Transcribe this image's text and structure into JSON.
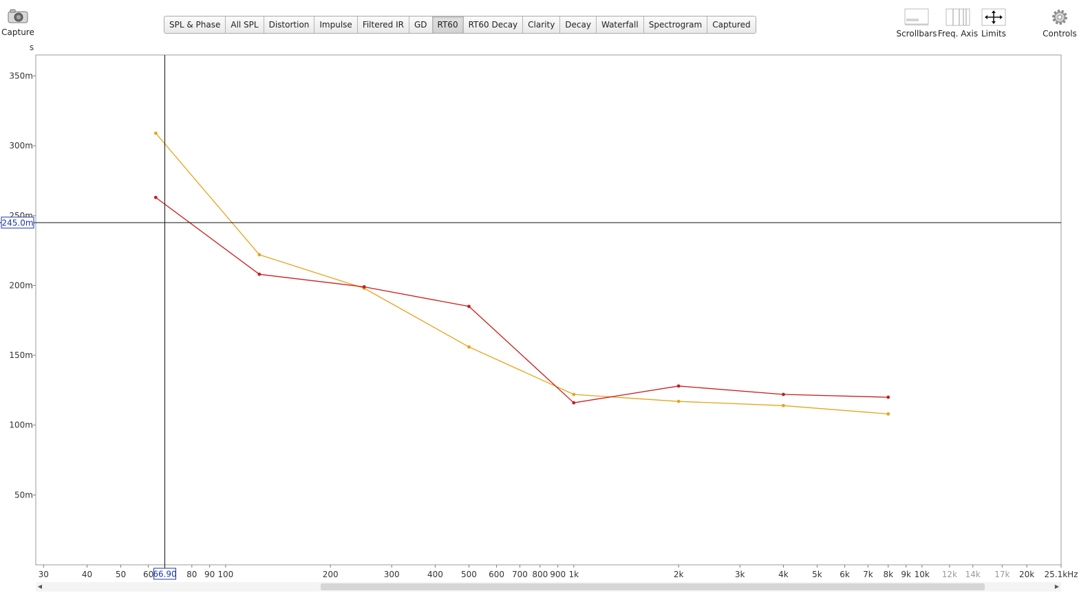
{
  "toolbar": {
    "capture": "Capture",
    "scrollbars": "Scrollbars",
    "freq_axis": "Freq. Axis",
    "limits": "Limits",
    "controls": "Controls"
  },
  "tabs": [
    {
      "label": "SPL & Phase"
    },
    {
      "label": "All SPL"
    },
    {
      "label": "Distortion"
    },
    {
      "label": "Impulse"
    },
    {
      "label": "Filtered IR"
    },
    {
      "label": "GD"
    },
    {
      "label": "RT60",
      "active": true
    },
    {
      "label": "RT60 Decay"
    },
    {
      "label": "Clarity"
    },
    {
      "label": "Decay"
    },
    {
      "label": "Waterfall"
    },
    {
      "label": "Spectrogram"
    },
    {
      "label": "Captured"
    }
  ],
  "cursor": {
    "freq_readout": "66.90",
    "value_readout": "245.0m",
    "freq": 66.9,
    "value": 0.245
  },
  "chart_data": {
    "type": "line",
    "ylabel": "s",
    "xscale": "log",
    "xlim": [
      28.5,
      25100
    ],
    "ylim": [
      0,
      0.365
    ],
    "grid": true,
    "yticks": [
      {
        "v": 0.05,
        "label": "50m"
      },
      {
        "v": 0.1,
        "label": "100m"
      },
      {
        "v": 0.15,
        "label": "150m"
      },
      {
        "v": 0.2,
        "label": "200m"
      },
      {
        "v": 0.25,
        "label": "250m"
      },
      {
        "v": 0.3,
        "label": "300m"
      },
      {
        "v": 0.35,
        "label": "350m"
      }
    ],
    "xticks": [
      {
        "v": 30,
        "label": "30"
      },
      {
        "v": 40,
        "label": "40"
      },
      {
        "v": 50,
        "label": "50"
      },
      {
        "v": 60,
        "label": "60"
      },
      {
        "v": 80,
        "label": "80"
      },
      {
        "v": 90,
        "label": "90"
      },
      {
        "v": 100,
        "label": "100"
      },
      {
        "v": 200,
        "label": "200"
      },
      {
        "v": 300,
        "label": "300"
      },
      {
        "v": 400,
        "label": "400"
      },
      {
        "v": 500,
        "label": "500"
      },
      {
        "v": 600,
        "label": "600"
      },
      {
        "v": 700,
        "label": "700"
      },
      {
        "v": 800,
        "label": "800"
      },
      {
        "v": 900,
        "label": "900"
      },
      {
        "v": 1000,
        "label": "1k"
      },
      {
        "v": 2000,
        "label": "2k"
      },
      {
        "v": 3000,
        "label": "3k"
      },
      {
        "v": 4000,
        "label": "4k"
      },
      {
        "v": 5000,
        "label": "5k"
      },
      {
        "v": 6000,
        "label": "6k"
      },
      {
        "v": 7000,
        "label": "7k"
      },
      {
        "v": 8000,
        "label": "8k"
      },
      {
        "v": 9000,
        "label": "9k"
      },
      {
        "v": 10000,
        "label": "10k"
      },
      {
        "v": 12000,
        "label": "12k",
        "faded": true
      },
      {
        "v": 14000,
        "label": "14k",
        "faded": true
      },
      {
        "v": 17000,
        "label": "17k",
        "faded": true
      },
      {
        "v": 20000,
        "label": "20k"
      },
      {
        "v": 25100,
        "label": "25.1kHz"
      }
    ],
    "valid_range_max": 10000,
    "series": [
      {
        "color": "#e8a317",
        "points": [
          [
            63,
            0.309
          ],
          [
            125,
            0.222
          ],
          [
            250,
            0.198
          ],
          [
            500,
            0.156
          ],
          [
            1000,
            0.122
          ],
          [
            2000,
            0.117
          ],
          [
            4000,
            0.114
          ],
          [
            8000,
            0.108
          ]
        ]
      },
      {
        "color": "#cc1a1a",
        "points": [
          [
            63,
            0.263
          ],
          [
            125,
            0.208
          ],
          [
            250,
            0.199
          ],
          [
            500,
            0.185
          ],
          [
            1000,
            0.116
          ],
          [
            2000,
            0.128
          ],
          [
            4000,
            0.122
          ],
          [
            8000,
            0.12
          ]
        ]
      }
    ]
  },
  "scrollbar": {
    "position": 0.27,
    "visible_fraction": 0.66
  }
}
